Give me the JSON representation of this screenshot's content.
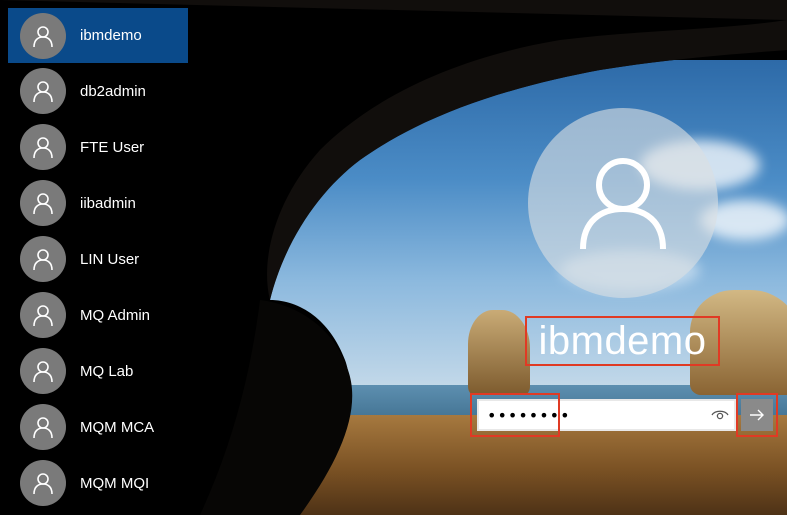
{
  "users": [
    {
      "name": "ibmdemo",
      "selected": true
    },
    {
      "name": "db2admin"
    },
    {
      "name": "FTE User"
    },
    {
      "name": "iibadmin"
    },
    {
      "name": "LIN User"
    },
    {
      "name": "MQ Admin"
    },
    {
      "name": "MQ Lab"
    },
    {
      "name": "MQM MCA"
    },
    {
      "name": "MQM MQI"
    }
  ],
  "login": {
    "username": "ibmdemo",
    "password_value": "••••••••",
    "reveal_icon": "eye-icon",
    "submit_icon": "arrow-right-icon"
  },
  "colors": {
    "selected_user_bg": "#0a4a8a",
    "highlight_border": "#e03a24"
  }
}
